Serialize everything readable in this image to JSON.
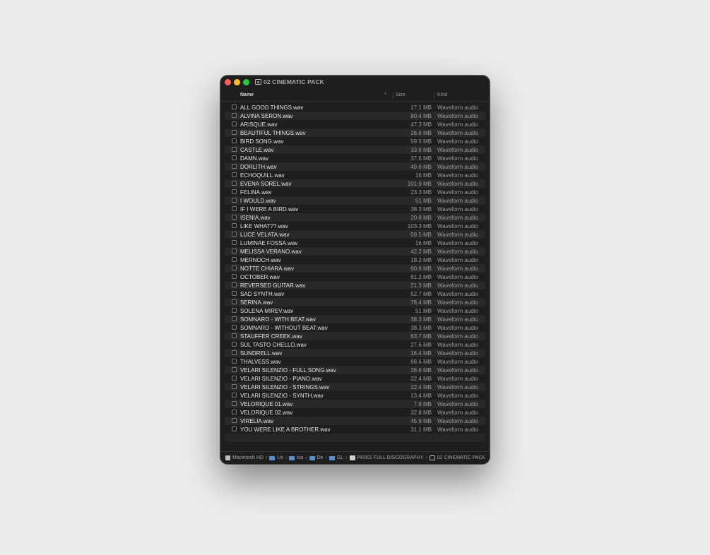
{
  "window": {
    "title": "02 CINEMATIC PACK",
    "title_icon": "folder-icon"
  },
  "columns": {
    "name": "Name",
    "size": "Size",
    "kind": "Kind",
    "sort_indicator": "^"
  },
  "files": [
    {
      "name": "ALL GOOD THINGS.wav",
      "size": "17.1 MB",
      "kind": "Waveform audio"
    },
    {
      "name": "ALVINA SERON.wav",
      "size": "80.4 MB",
      "kind": "Waveform audio"
    },
    {
      "name": "ARISQUE.wav",
      "size": "47.3 MB",
      "kind": "Waveform audio"
    },
    {
      "name": "BEAUTIFUL THINGS.wav",
      "size": "26.6 MB",
      "kind": "Waveform audio"
    },
    {
      "name": "BIRD SONG.wav",
      "size": "59.5 MB",
      "kind": "Waveform audio"
    },
    {
      "name": "CASTLE.wav",
      "size": "33.6 MB",
      "kind": "Waveform audio"
    },
    {
      "name": "DAMN.wav",
      "size": "37.6 MB",
      "kind": "Waveform audio"
    },
    {
      "name": "DORLITH.wav",
      "size": "49.6 MB",
      "kind": "Waveform audio"
    },
    {
      "name": "ECHOQUILL.wav",
      "size": "16 MB",
      "kind": "Waveform audio"
    },
    {
      "name": "EVENA SOREL.wav",
      "size": "101.9 MB",
      "kind": "Waveform audio"
    },
    {
      "name": "FELINA.wav",
      "size": "23.3 MB",
      "kind": "Waveform audio"
    },
    {
      "name": "I WOULD.wav",
      "size": "51 MB",
      "kind": "Waveform audio"
    },
    {
      "name": "IF I WERE A BIRD.wav",
      "size": "38.3 MB",
      "kind": "Waveform audio"
    },
    {
      "name": "ISENIA.wav",
      "size": "20.8 MB",
      "kind": "Waveform audio"
    },
    {
      "name": "LIKE WHAT??.wav",
      "size": "103.3 MB",
      "kind": "Waveform audio"
    },
    {
      "name": "LUCE VELATA.wav",
      "size": "59.5 MB",
      "kind": "Waveform audio"
    },
    {
      "name": "LUMINAE FOSSA.wav",
      "size": "16 MB",
      "kind": "Waveform audio"
    },
    {
      "name": "MELISSA VERANO.wav",
      "size": "42.2 MB",
      "kind": "Waveform audio"
    },
    {
      "name": "MERNOCH.wav",
      "size": "18.2 MB",
      "kind": "Waveform audio"
    },
    {
      "name": "NOTTE CHIARA.wav",
      "size": "60.6 MB",
      "kind": "Waveform audio"
    },
    {
      "name": "OCTOBER.wav",
      "size": "61.2 MB",
      "kind": "Waveform audio"
    },
    {
      "name": "REVERSED GUITAR.wav",
      "size": "21.3 MB",
      "kind": "Waveform audio"
    },
    {
      "name": "SAD SYNTH.wav",
      "size": "52.7 MB",
      "kind": "Waveform audio"
    },
    {
      "name": "SERINA.wav",
      "size": "76.4 MB",
      "kind": "Waveform audio"
    },
    {
      "name": "SOLENA MIREV.wav",
      "size": "51 MB",
      "kind": "Waveform audio"
    },
    {
      "name": "SOMNARO - WITH BEAT.wav",
      "size": "38.3 MB",
      "kind": "Waveform audio"
    },
    {
      "name": "SOMNARO - WITHOUT BEAT.wav",
      "size": "38.3 MB",
      "kind": "Waveform audio"
    },
    {
      "name": "STAUFFER CREEK.wav",
      "size": "63.7 MB",
      "kind": "Waveform audio"
    },
    {
      "name": "SUL TASTO CHELLO.wav",
      "size": "27.6 MB",
      "kind": "Waveform audio"
    },
    {
      "name": "SUNDRELL.wav",
      "size": "16.4 MB",
      "kind": "Waveform audio"
    },
    {
      "name": "THALVESS.wav",
      "size": "68.6 MB",
      "kind": "Waveform audio"
    },
    {
      "name": "VELARI SILENZIO - FULL SONG.wav",
      "size": "26.6 MB",
      "kind": "Waveform audio"
    },
    {
      "name": "VELARI SILENZIO - PIANO.wav",
      "size": "22.4 MB",
      "kind": "Waveform audio"
    },
    {
      "name": "VELARI SILENZIO - STRINGS.wav",
      "size": "22.4 MB",
      "kind": "Waveform audio"
    },
    {
      "name": "VELARI SILENZIO - SYNTH.wav",
      "size": "13.4 MB",
      "kind": "Waveform audio"
    },
    {
      "name": "VELORIQUE 01.wav",
      "size": "7.8 MB",
      "kind": "Waveform audio"
    },
    {
      "name": "VELORIQUE 02.wav",
      "size": "32.8 MB",
      "kind": "Waveform audio"
    },
    {
      "name": "VIRELIA.wav",
      "size": "45.9 MB",
      "kind": "Waveform audio"
    },
    {
      "name": "YOU WERE LIKE A BROTHER.wav",
      "size": "31.1 MB",
      "kind": "Waveform audio"
    }
  ],
  "path": {
    "separator": "›",
    "items": [
      {
        "label": "Macintosh HD",
        "icon": "disk-icon"
      },
      {
        "label": "Us",
        "icon": "folder-icon"
      },
      {
        "label": "isa",
        "icon": "folder-icon"
      },
      {
        "label": "De",
        "icon": "folder-icon"
      },
      {
        "label": "GL",
        "icon": "folder-icon"
      },
      {
        "label": "PR001 FULL DISCOGRAPHY",
        "icon": "document-icon"
      },
      {
        "label": "02 CINEMATIC PACK",
        "icon": "folder-icon"
      }
    ]
  },
  "colors": {
    "window_bg": "#1e1e1e",
    "row_alt": "#292929",
    "close": "#fe5f57",
    "minimize": "#febc2e",
    "zoom": "#28c840"
  }
}
